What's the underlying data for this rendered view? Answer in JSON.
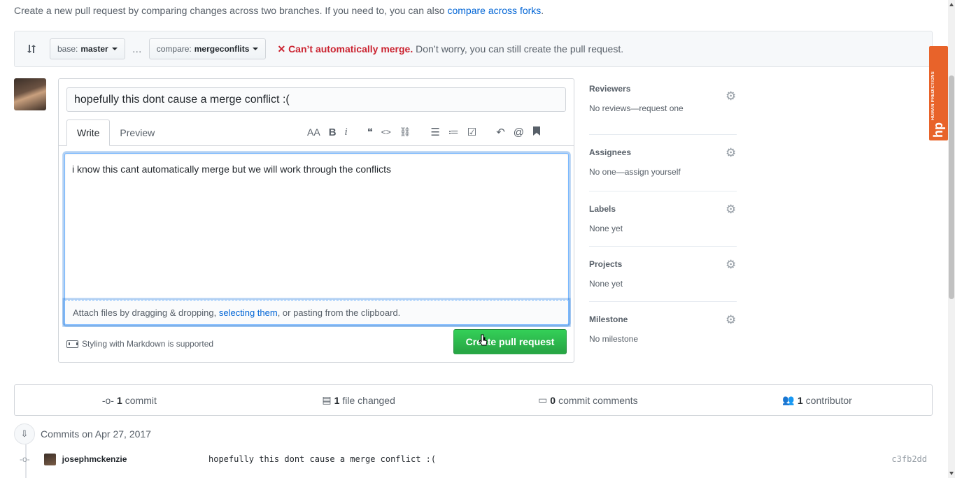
{
  "intro": {
    "text": "Create a new pull request by comparing changes across two branches. If you need to, you can also ",
    "link": "compare across forks",
    "suffix": "."
  },
  "range": {
    "base_prefix": "base:",
    "base_branch": "master",
    "ellipsis": "…",
    "compare_prefix": "compare:",
    "compare_branch": "mergeconflits",
    "status_icon": "✕",
    "status_error": "Can’t automatically merge.",
    "status_note": "Don’t worry, you can still create the pull request."
  },
  "form": {
    "title_value": "hopefully this dont cause a merge conflict :(",
    "tabs": [
      {
        "label": "Write"
      },
      {
        "label": "Preview"
      }
    ],
    "toolbar": {
      "text_size": "AA",
      "bold": "B",
      "italic": "i",
      "quote": "❝",
      "code": "<>",
      "link": "⛓",
      "ul": "☰",
      "ol": "≔",
      "task": "☑",
      "reply": "↶",
      "mention": "@",
      "bookmark": "🔖"
    },
    "body_value": "i know this cant automatically merge but we will work through the conflicts",
    "attach_prefix": "Attach files by dragging & dropping, ",
    "attach_link": "selecting them",
    "attach_suffix": ", or pasting from the clipboard.",
    "markdown_note": "Styling with Markdown is supported",
    "create_button": "Create pull request"
  },
  "sidebar": {
    "sections": [
      {
        "title": "Reviewers",
        "value": "No reviews—request one"
      },
      {
        "title": "Assignees",
        "value": "No one—assign yourself"
      },
      {
        "title": "Labels",
        "value": "None yet"
      },
      {
        "title": "Projects",
        "value": "None yet"
      },
      {
        "title": "Milestone",
        "value": "No milestone"
      }
    ]
  },
  "stats": {
    "commits_count": "1",
    "commits_label": "commit",
    "files_count": "1",
    "files_label": "file changed",
    "comments_count": "0",
    "comments_label": "commit comments",
    "contributors_count": "1",
    "contributors_label": "contributor"
  },
  "commits": {
    "heading": "Commits on Apr 27, 2017",
    "items": [
      {
        "author": "josephmckenzie",
        "message": "hopefully this dont cause a merge conflict :(",
        "sha": "c3fb2dd"
      }
    ]
  },
  "extension": {
    "label": "HUMAN PREDICTIONS",
    "logo": "hp"
  },
  "colors": {
    "accent": "#0366d6",
    "error": "#cb2431",
    "create_button": "#28a745",
    "extension_tab": "#e8632a"
  }
}
